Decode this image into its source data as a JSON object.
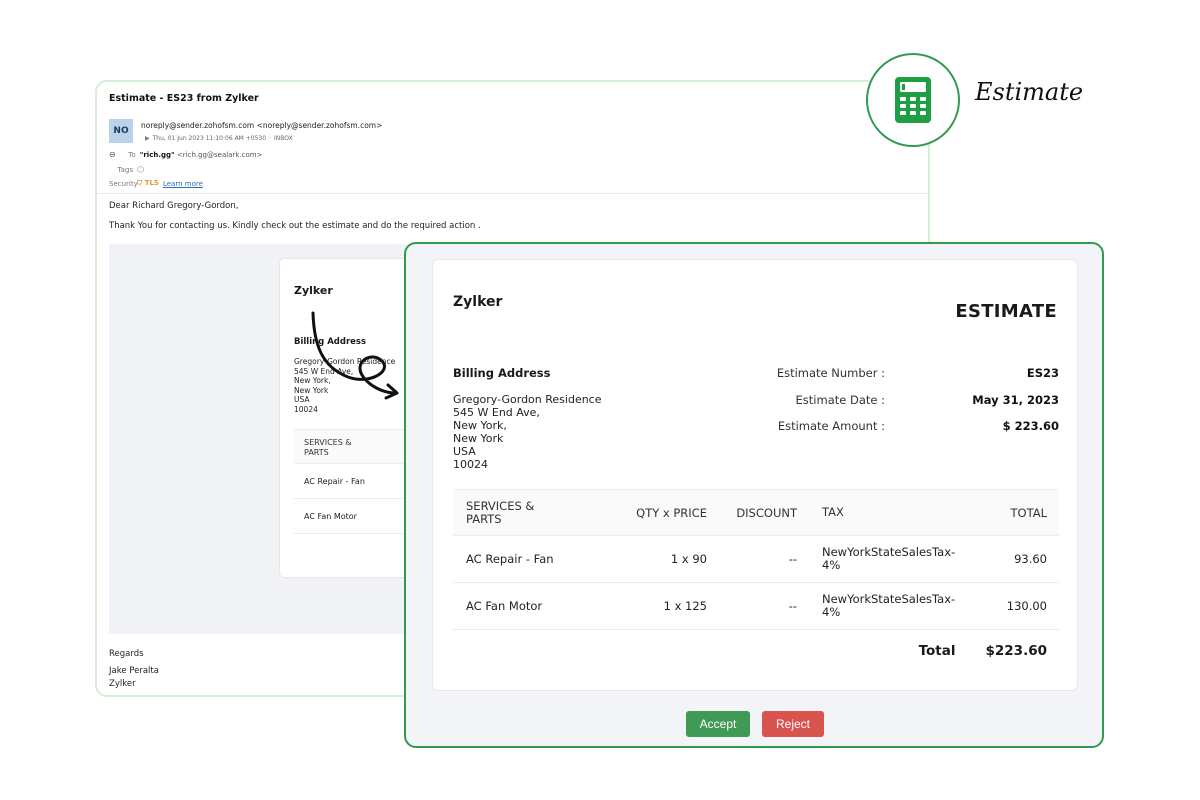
{
  "email": {
    "subject": "Estimate - ES23 from Zylker",
    "avatar_initials": "NO",
    "from": "noreply@sender.zohofsm.com <noreply@sender.zohofsm.com>",
    "date": "Thu, 01 Jun 2023 11:10:06 AM +0530",
    "folder": "INBOX",
    "to_label": "To",
    "to_name": "\"rich.gg\"",
    "to_email": "<rich.gg@sealark.com>",
    "tags_label": "Tags",
    "security_label": "Security",
    "security_value": "TLS",
    "learn_more": "Learn more",
    "greeting": "Dear Richard Gregory-Gordon,",
    "body": "Thank You for contacting us. Kindly check out the estimate and do the required action .",
    "regards": "Regards",
    "signer": "Jake Peralta",
    "signer_company": "Zylker"
  },
  "estimate": {
    "company": "Zylker",
    "title": "ESTIMATE",
    "billing_title": "Billing Address",
    "address": [
      "Gregory-Gordon Residence",
      "545 W End Ave,",
      "New York,",
      "New York",
      "USA",
      "10024"
    ],
    "meta": [
      {
        "label": "Estimate Number :",
        "value": "ES23"
      },
      {
        "label": "Estimate Date :",
        "value": "May 31, 2023"
      },
      {
        "label": "Estimate Amount :",
        "value": "$ 223.60"
      }
    ],
    "columns": {
      "item": "SERVICES & PARTS",
      "qty": "QTY x PRICE",
      "discount": "DISCOUNT",
      "tax": "TAX",
      "total": "TOTAL"
    },
    "rows": [
      {
        "item": "AC Repair - Fan",
        "qty": "1 x 90",
        "discount": "--",
        "tax": "NewYorkStateSalesTax-4%",
        "total": "93.60"
      },
      {
        "item": "AC Fan Motor",
        "qty": "1 x 125",
        "discount": "--",
        "tax": "NewYorkStateSalesTax-4%",
        "total": "130.00"
      }
    ],
    "total_label": "Total",
    "total_value": "$223.60",
    "accept_label": "Accept",
    "reject_label": "Reject"
  },
  "badge": {
    "label": "Estimate",
    "icon": "calculator-icon",
    "accent_color": "#2f9a50",
    "icon_color": "#1e9e45"
  },
  "colors": {
    "accept": "#3f9a56",
    "reject": "#d9534f",
    "panel_border": "#2f9a50"
  }
}
